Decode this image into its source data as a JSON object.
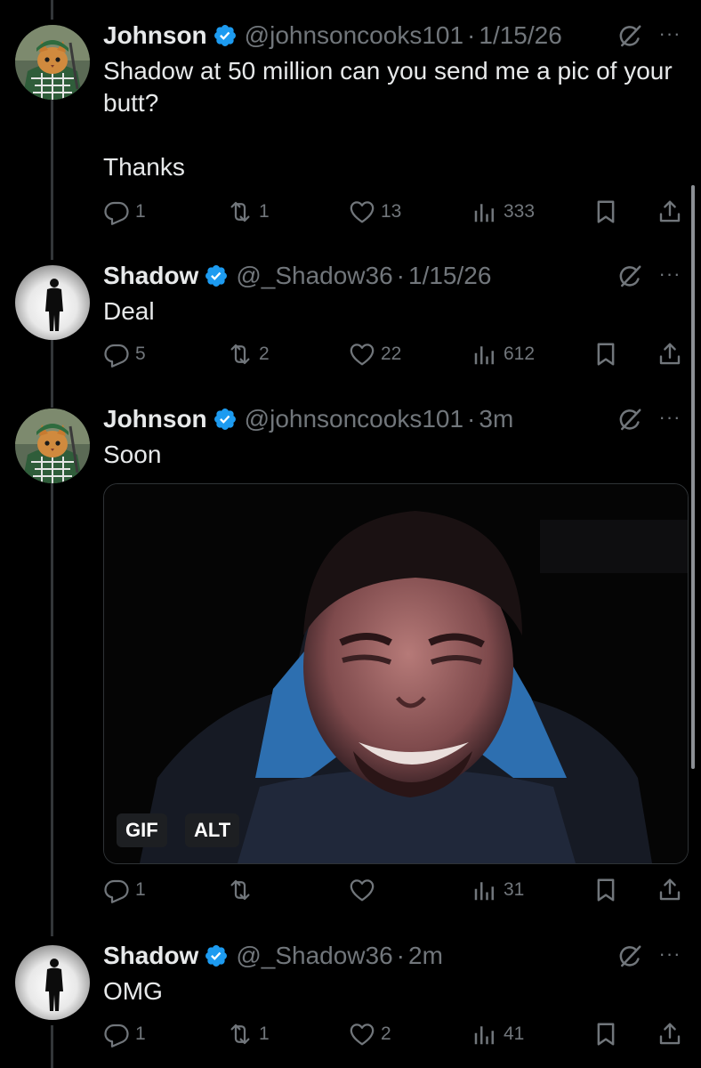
{
  "tweets": [
    {
      "name": "Johnson",
      "handle": "@johnsoncooks101",
      "time": "1/15/26",
      "text": "Shadow at 50 million can you send me a pic of your butt?\n\nThanks",
      "replies": "1",
      "reposts": "1",
      "likes": "13",
      "views": "333",
      "avatar": "cat-avatar"
    },
    {
      "name": "Shadow",
      "handle": "@_Shadow36",
      "time": "1/15/26",
      "text": "Deal",
      "replies": "5",
      "reposts": "2",
      "likes": "22",
      "views": "612",
      "avatar": "silhouette-avatar"
    },
    {
      "name": "Johnson",
      "handle": "@johnsoncooks101",
      "time": "3m",
      "text": "Soon",
      "replies": "1",
      "reposts": "",
      "likes": "",
      "views": "31",
      "avatar": "cat-avatar",
      "media": {
        "badge_gif": "GIF",
        "badge_alt": "ALT"
      }
    },
    {
      "name": "Shadow",
      "handle": "@_Shadow36",
      "time": "2m",
      "text": "OMG",
      "replies": "1",
      "reposts": "1",
      "likes": "2",
      "views": "41",
      "avatar": "silhouette-avatar"
    }
  ],
  "separator": "·",
  "more_label": "···",
  "colors": {
    "background": "#000000",
    "text": "#e7e9ea",
    "muted": "#71767b",
    "verified": "#1d9bf0"
  }
}
